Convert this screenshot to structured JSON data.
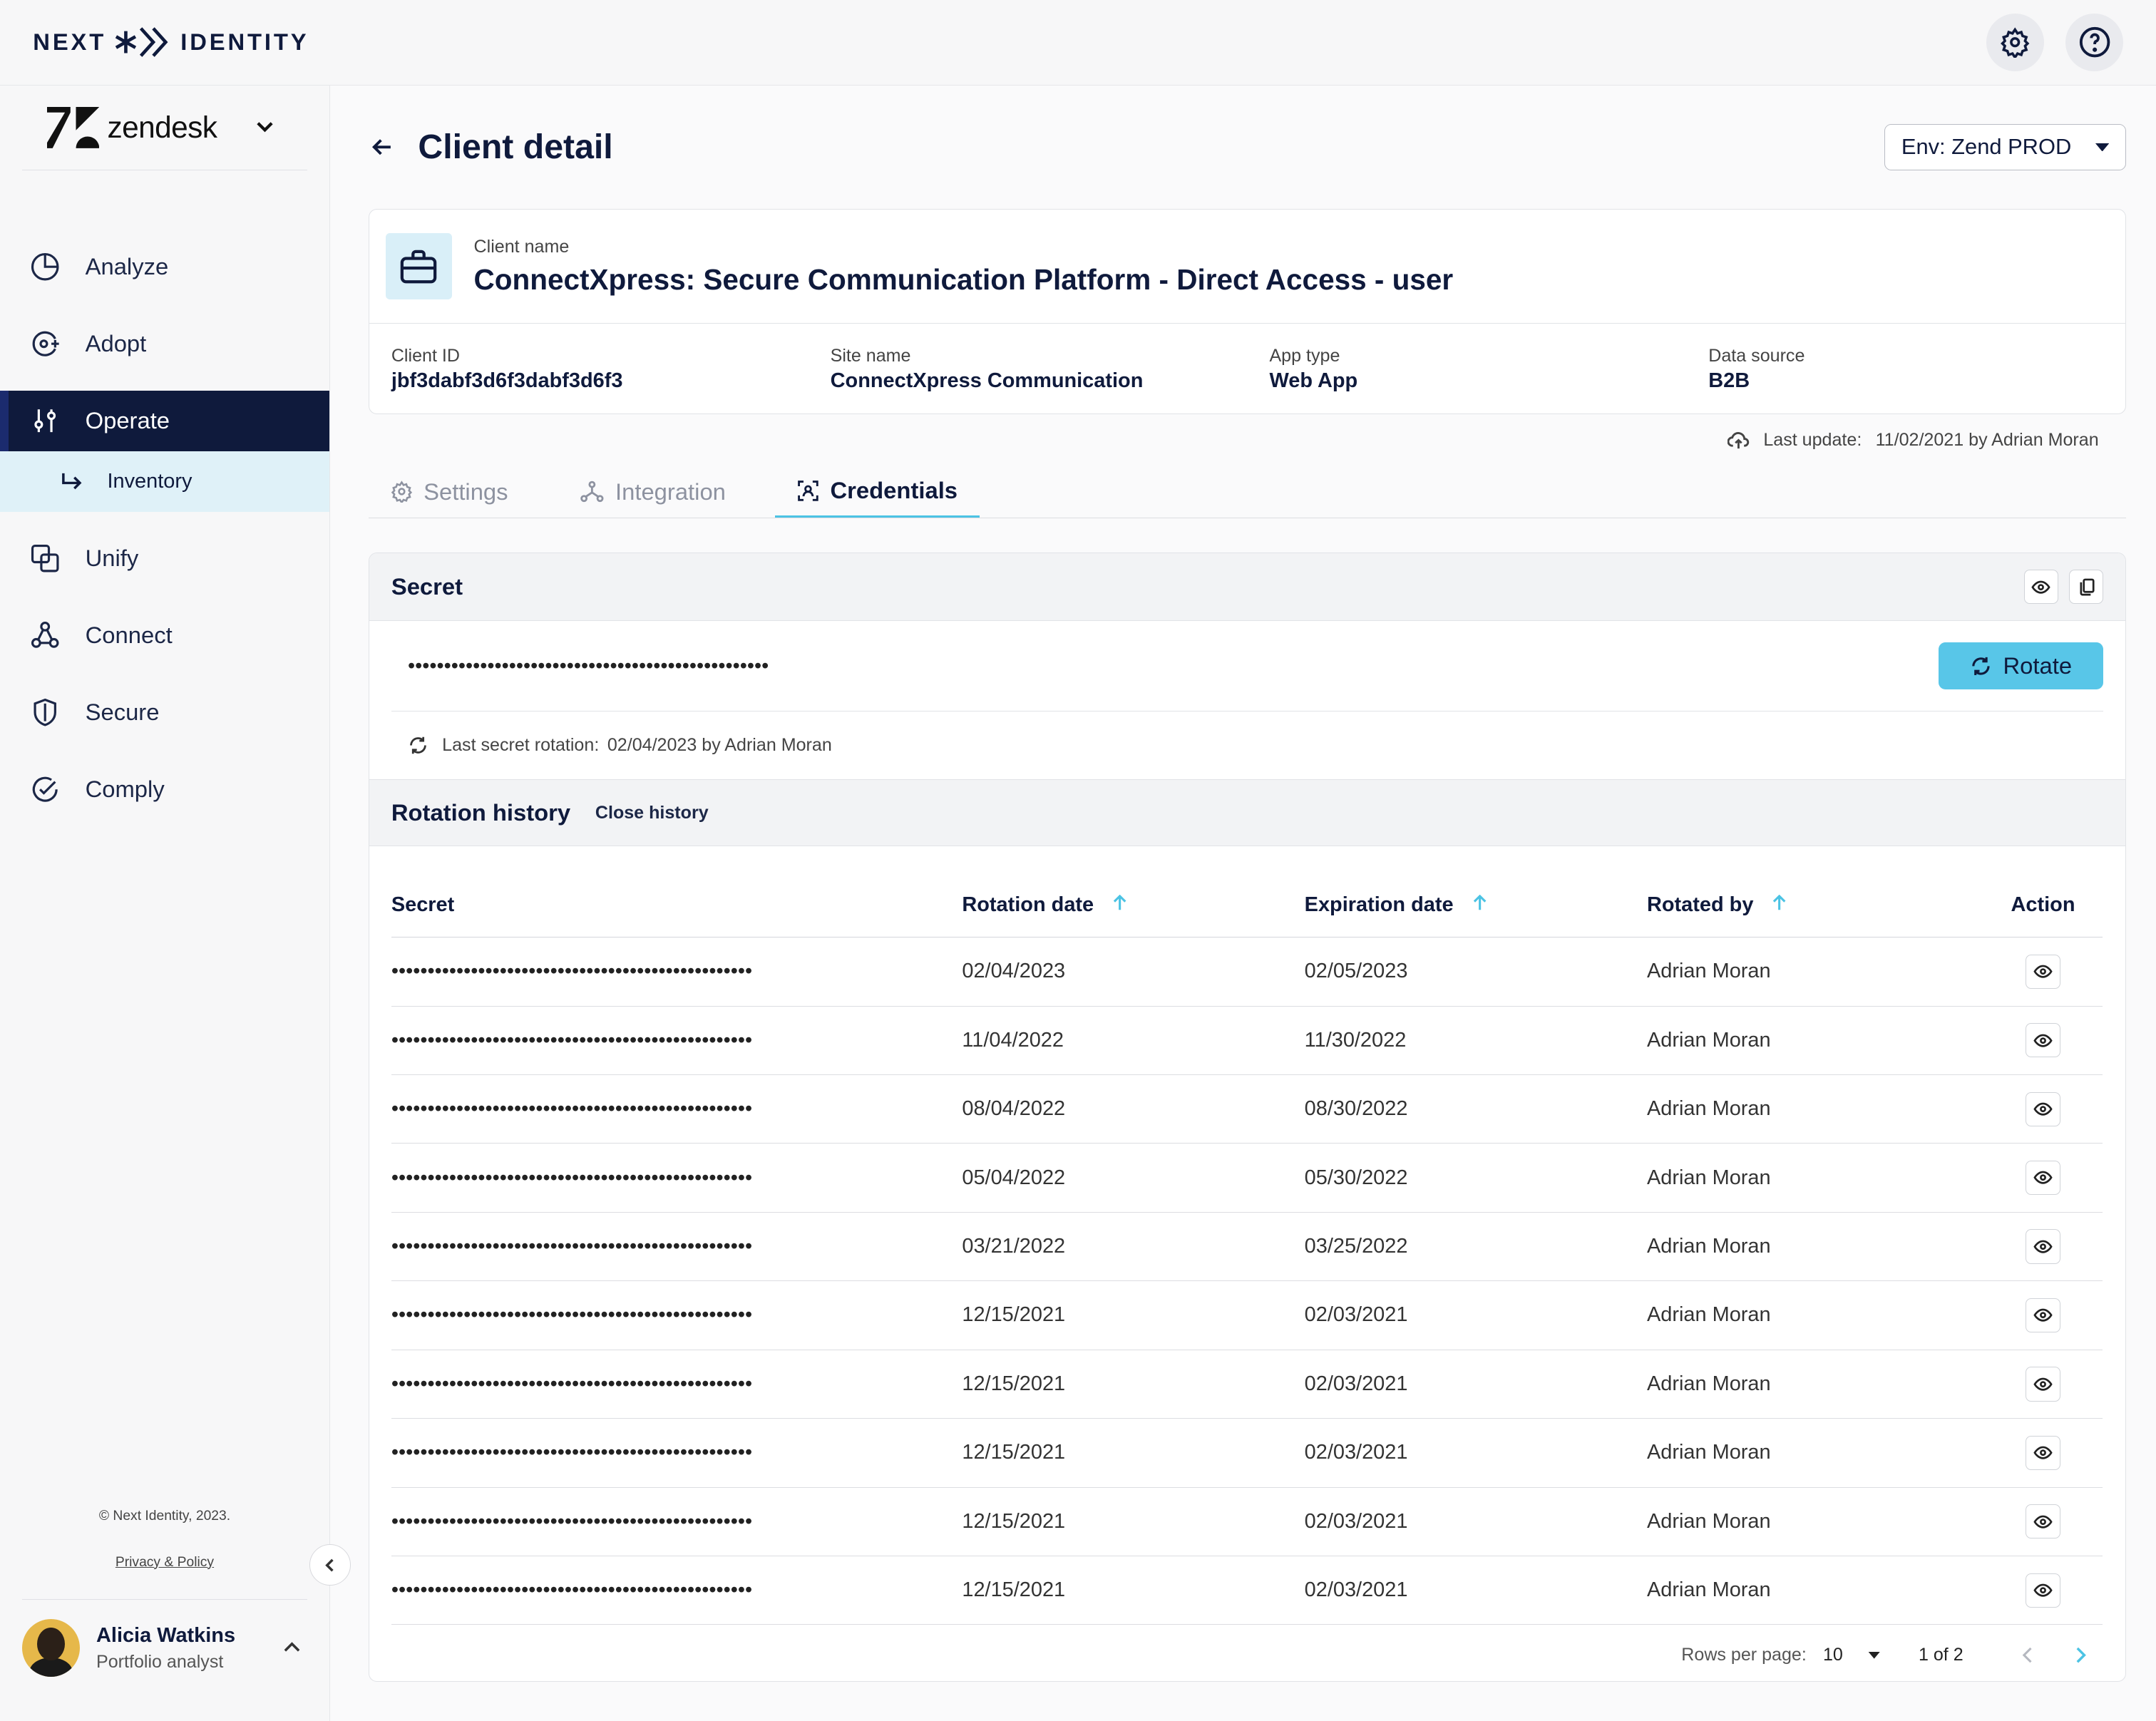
{
  "app": {
    "brand_left": "NEXT",
    "brand_right": "IDENTITY"
  },
  "sidebar": {
    "org": "zendesk",
    "items": [
      {
        "label": "Analyze"
      },
      {
        "label": "Adopt"
      },
      {
        "label": "Operate"
      },
      {
        "label": "Unify"
      },
      {
        "label": "Connect"
      },
      {
        "label": "Secure"
      },
      {
        "label": "Comply"
      }
    ],
    "sub_item": "Inventory",
    "copyright": "© Next Identity, 2023.",
    "privacy": "Privacy & Policy",
    "user": {
      "name": "Alicia Watkins",
      "role": "Portfolio analyst"
    }
  },
  "page": {
    "title": "Client detail",
    "env": "Env: Zend PROD"
  },
  "client": {
    "name_label": "Client name",
    "name": "ConnectXpress: Secure Communication Platform - Direct Access - user",
    "id_label": "Client ID",
    "id": "jbf3dabf3d6f3dabf3d6f3",
    "site_label": "Site name",
    "site": "ConnectXpress Communication",
    "app_label": "App type",
    "app": "Web App",
    "source_label": "Data source",
    "source": "B2B",
    "last_update_label": "Last update:",
    "last_update": "11/02/2021 by Adrian Moran"
  },
  "tabs": [
    {
      "label": "Settings"
    },
    {
      "label": "Integration"
    },
    {
      "label": "Credentials"
    }
  ],
  "secret": {
    "heading": "Secret",
    "masked": "••••••••••••••••••••••••••••••••••••••••••••••••••",
    "rotate_label": "Rotate",
    "last_rotation_label": "Last secret rotation:",
    "last_rotation": "02/04/2023 by Adrian Moran"
  },
  "history": {
    "heading": "Rotation history",
    "close_label": "Close history",
    "columns": [
      "Secret",
      "Rotation date",
      "Expiration date",
      "Rotated by",
      "Action"
    ],
    "rows": [
      {
        "secret": "••••••••••••••••••••••••••••••••••••••••••••••••••",
        "rotation": "02/04/2023",
        "expiration": "02/05/2023",
        "by": "Adrian Moran"
      },
      {
        "secret": "••••••••••••••••••••••••••••••••••••••••••••••••••",
        "rotation": "11/04/2022",
        "expiration": "11/30/2022",
        "by": "Adrian Moran"
      },
      {
        "secret": "••••••••••••••••••••••••••••••••••••••••••••••••••",
        "rotation": "08/04/2022",
        "expiration": "08/30/2022",
        "by": "Adrian Moran"
      },
      {
        "secret": "••••••••••••••••••••••••••••••••••••••••••••••••••",
        "rotation": "05/04/2022",
        "expiration": "05/30/2022",
        "by": "Adrian Moran"
      },
      {
        "secret": "••••••••••••••••••••••••••••••••••••••••••••••••••",
        "rotation": "03/21/2022",
        "expiration": "03/25/2022",
        "by": "Adrian Moran"
      },
      {
        "secret": "••••••••••••••••••••••••••••••••••••••••••••••••••",
        "rotation": "12/15/2021",
        "expiration": "02/03/2021",
        "by": "Adrian Moran"
      },
      {
        "secret": "••••••••••••••••••••••••••••••••••••••••••••••••••",
        "rotation": "12/15/2021",
        "expiration": "02/03/2021",
        "by": "Adrian Moran"
      },
      {
        "secret": "••••••••••••••••••••••••••••••••••••••••••••••••••",
        "rotation": "12/15/2021",
        "expiration": "02/03/2021",
        "by": "Adrian Moran"
      },
      {
        "secret": "••••••••••••••••••••••••••••••••••••••••••••••••••",
        "rotation": "12/15/2021",
        "expiration": "02/03/2021",
        "by": "Adrian Moran"
      },
      {
        "secret": "••••••••••••••••••••••••••••••••••••••••••••••••••",
        "rotation": "12/15/2021",
        "expiration": "02/03/2021",
        "by": "Adrian Moran"
      }
    ],
    "rows_per_page_label": "Rows per page:",
    "rows_per_page": "10",
    "page_info": "1 of 2"
  },
  "colors": {
    "navy": "#0f1a3c",
    "accent": "#58c6e8",
    "accent_line": "#4cc3e4"
  }
}
